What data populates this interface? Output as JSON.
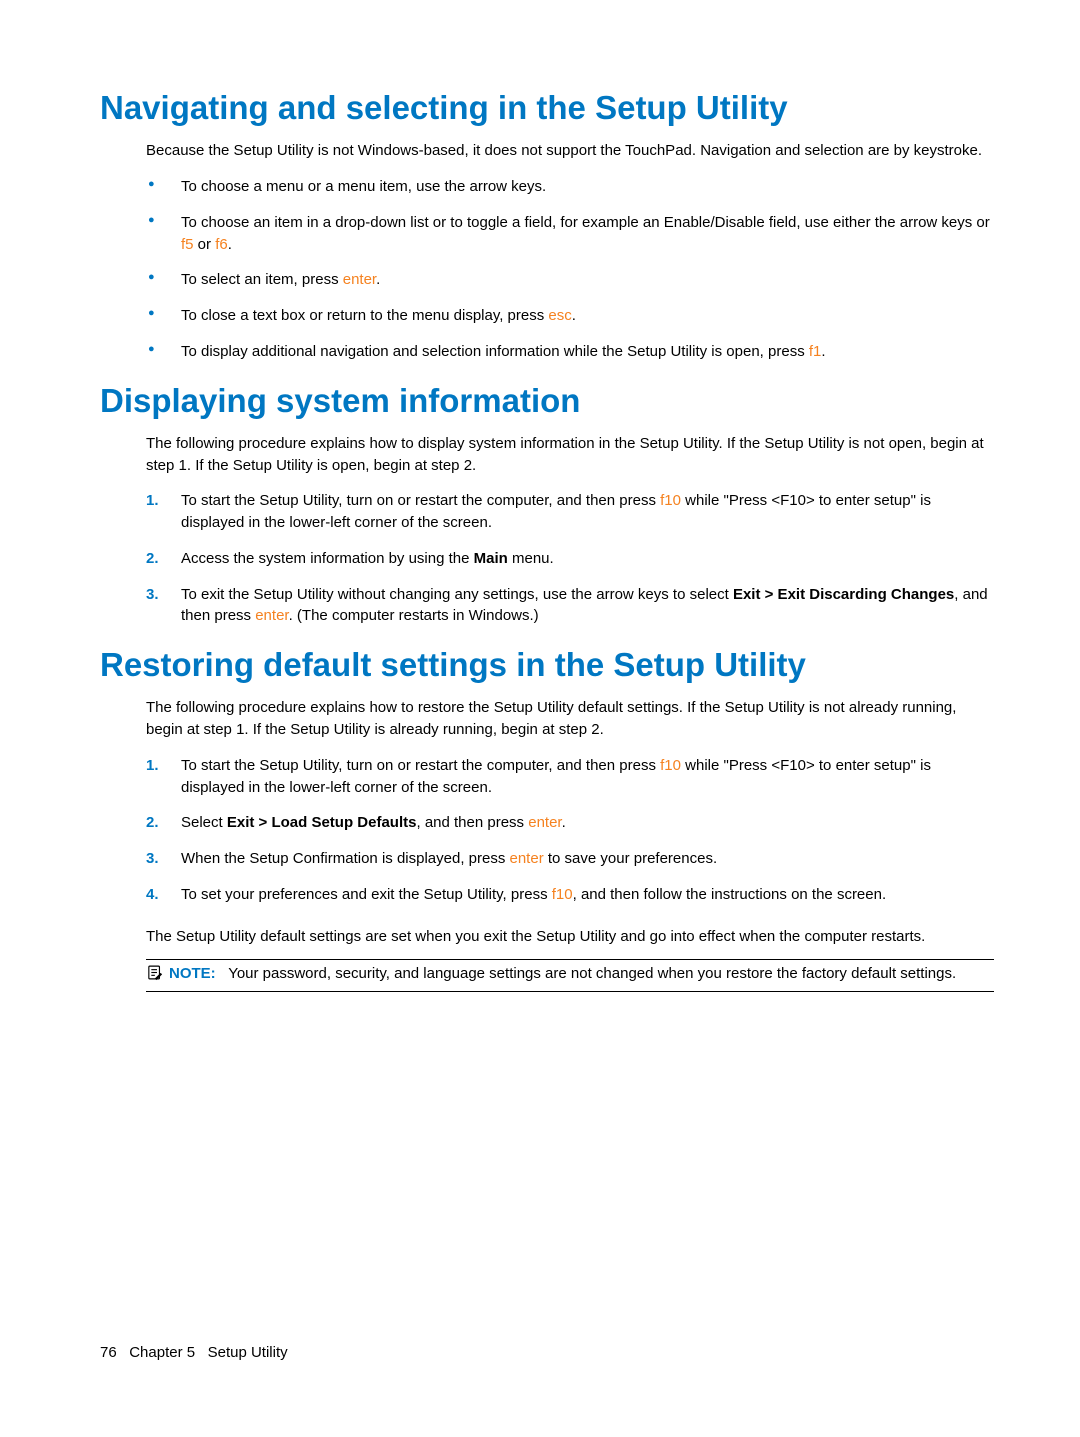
{
  "s1": {
    "heading": "Navigating and selecting in the Setup Utility",
    "intro": "Because the Setup Utility is not Windows-based, it does not support the TouchPad. Navigation and selection are by keystroke.",
    "b1": "To choose a menu or a menu item, use the arrow keys.",
    "b2a": "To choose an item in a drop-down list or to toggle a field, for example an Enable/Disable field, use either the arrow keys or ",
    "b2k1": "f5",
    "b2b": " or ",
    "b2k2": "f6",
    "b2c": ".",
    "b3a": "To select an item, press ",
    "b3k": "enter",
    "b3b": ".",
    "b4a": "To close a text box or return to the menu display, press ",
    "b4k": "esc",
    "b4b": ".",
    "b5a": "To display additional navigation and selection information while the Setup Utility is open, press ",
    "b5k": "f1",
    "b5b": "."
  },
  "s2": {
    "heading": "Displaying system information",
    "intro": "The following procedure explains how to display system information in the Setup Utility. If the Setup Utility is not open, begin at step 1. If the Setup Utility is open, begin at step 2.",
    "n1a": "To start the Setup Utility, turn on or restart the computer, and then press ",
    "n1k": "f10",
    "n1b": " while \"Press <F10> to enter setup\" is displayed in the lower-left corner of the screen.",
    "n2a": "Access the system information by using the ",
    "n2bold": "Main",
    "n2b": " menu.",
    "n3a": "To exit the Setup Utility without changing any settings, use the arrow keys to select ",
    "n3bold": "Exit > Exit Discarding Changes",
    "n3b": ", and then press ",
    "n3k": "enter",
    "n3c": ". (The computer restarts in Windows.)"
  },
  "s3": {
    "heading": "Restoring default settings in the Setup Utility",
    "intro": "The following procedure explains how to restore the Setup Utility default settings. If the Setup Utility is not already running, begin at step 1. If the Setup Utility is already running, begin at step 2.",
    "n1a": "To start the Setup Utility, turn on or restart the computer, and then press ",
    "n1k": "f10",
    "n1b": " while \"Press <F10> to enter setup\" is displayed in the lower-left corner of the screen.",
    "n2a": "Select ",
    "n2bold": "Exit > Load Setup Defaults",
    "n2b": ", and then press ",
    "n2k": "enter",
    "n2c": ".",
    "n3a": "When the Setup Confirmation is displayed, press ",
    "n3k": "enter",
    "n3b": " to save your preferences.",
    "n4a": "To set your preferences and exit the Setup Utility, press ",
    "n4k": "f10",
    "n4b": ", and then follow the instructions on the screen.",
    "after": "The Setup Utility default settings are set when you exit the Setup Utility and go into effect when the computer restarts.",
    "note_label": "NOTE:",
    "note_text": "Your password, security, and language settings are not changed when you restore the factory default settings."
  },
  "footer": {
    "page": "76",
    "chapter": "Chapter 5",
    "title": "Setup Utility"
  }
}
